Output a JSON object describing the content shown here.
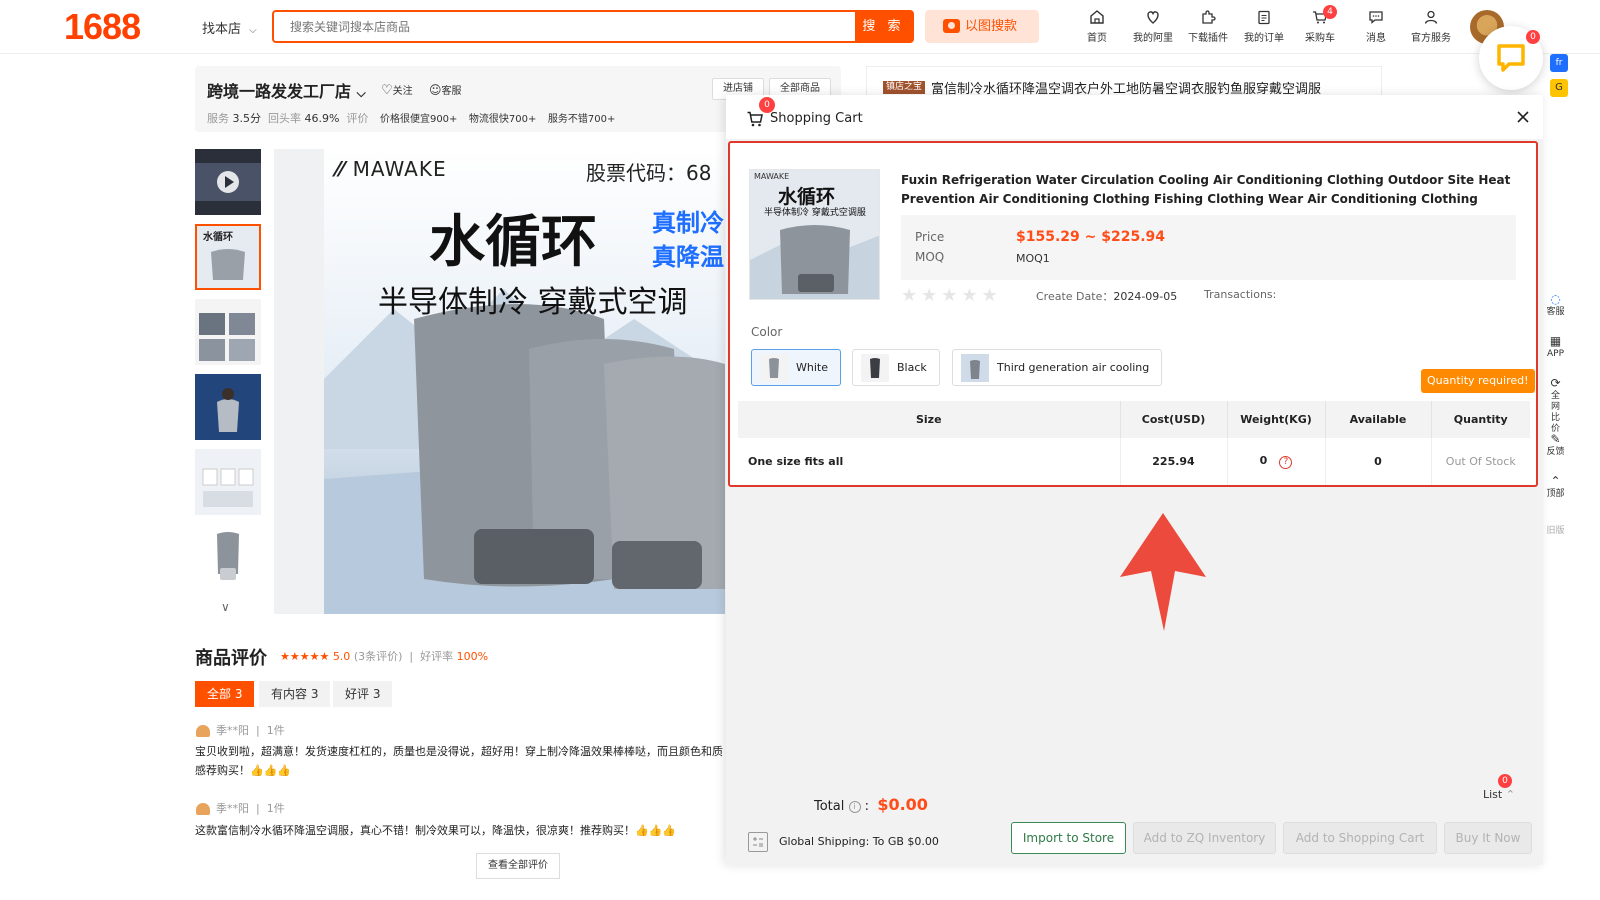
{
  "header": {
    "logo": "1688",
    "find_shop": "找本店",
    "search_placeholder": "搜索关键词搜本店商品",
    "search_button": "搜 索",
    "image_search": "以图搜款",
    "nav": [
      {
        "label": "首页",
        "icon": "home-icon"
      },
      {
        "label": "我的阿里",
        "icon": "heart-shield-icon"
      },
      {
        "label": "下载插件",
        "icon": "puzzle-icon"
      },
      {
        "label": "我的订单",
        "icon": "clipboard-icon"
      },
      {
        "label": "采购车",
        "icon": "cart-icon",
        "badge": "4"
      },
      {
        "label": "消息",
        "icon": "message-icon"
      },
      {
        "label": "官方服务",
        "icon": "user-icon"
      }
    ],
    "chat_badge": "0",
    "side_tags": [
      "fr",
      "G"
    ]
  },
  "right_rail": [
    "客服",
    "APP",
    "全网比价",
    "反馈",
    "顶部",
    "旧版"
  ],
  "shop": {
    "name": "跨境一路发发工厂店",
    "follow": "关注",
    "service": "客服",
    "enter_shop": "进店铺",
    "all_products": "全部商品",
    "stats": {
      "service_label": "服务",
      "service_val": "3.5分",
      "repeat_label": "回头率",
      "repeat_val": "46.9%",
      "review_label": "评价",
      "tags": [
        "价格很便宜900+",
        "物流很快700+",
        "服务不错700+"
      ]
    }
  },
  "main_image": {
    "brand": "MAWAKE",
    "stock_code": "股票代码：68",
    "headline": "水循环",
    "blue_line1": "真制冷",
    "blue_line2": "真降温",
    "subline": "半导体制冷 穿戴式空调"
  },
  "reviews": {
    "title": "商品评价",
    "stars": "★★★★★",
    "score": "5.0",
    "count": "(3条评价)",
    "good_rate_label": "好评率",
    "good_rate": "100%",
    "tabs": [
      "全部 3",
      "有内容 3",
      "好评 3"
    ],
    "items": [
      {
        "user": "季**阳",
        "qty": "1件",
        "text": "宝贝收到啦，超满意！发货速度杠杠的，质量也是没得说，超好用！穿上制冷降温效果棒棒哒，而且颜色和质感荐购买！👍👍👍"
      },
      {
        "user": "季**阳",
        "qty": "1件",
        "text": "这款富信制冷水循环降温空调服，真心不错！制冷效果可以，降温快，很凉爽！推荐购买！👍👍👍"
      }
    ],
    "see_all": "查看全部评价"
  },
  "recommend": {
    "tag": "镇店之宝",
    "title": "富信制冷水循环降温空调衣户外工地防暑空调衣服钓鱼服穿戴空调服"
  },
  "cart": {
    "title": "Shopping Cart",
    "badge": "0",
    "product": {
      "thumb_brand": "MAWAKE",
      "thumb_headline": "水循环",
      "thumb_sub": "半导体制冷 穿戴式空调服",
      "title": "Fuxin Refrigeration Water Circulation Cooling Air Conditioning Clothing Outdoor Site Heat Prevention Air Conditioning Clothing Fishing Clothing Wear Air Conditioning Clothing",
      "price_label": "Price",
      "price": "$155.29 ~ $225.94",
      "moq_label": "MOQ",
      "moq": "MOQ1",
      "stars": "★★★★★",
      "create_date_label": "Create Date：",
      "create_date": "2024-09-05",
      "transactions_label": "Transactions:"
    },
    "color_label": "Color",
    "colors": [
      {
        "label": "White",
        "selected": true
      },
      {
        "label": "Black",
        "selected": false
      },
      {
        "label": "Third generation air cooling",
        "selected": false
      }
    ],
    "quantity_required": "Quantity required!",
    "table": {
      "headers": [
        "Size",
        "Cost(USD)",
        "Weight(KG)",
        "Available",
        "Quantity"
      ],
      "rows": [
        {
          "size": "One size fits all",
          "cost": "225.94",
          "weight": "0",
          "weight_hint": "?",
          "available": "0",
          "quantity": "Out Of Stock"
        }
      ]
    },
    "total_label": "Total",
    "total": "$0.00",
    "list_label": "List",
    "list_badge": "0",
    "shipping": "Global Shipping:  To GB $0.00",
    "buttons": {
      "import": "Import to Store",
      "zq": "Add to ZQ Inventory",
      "cart": "Add to Shopping Cart",
      "buy": "Buy It Now"
    },
    "accent": "#e0392b",
    "price_color": "#ff4d1a"
  }
}
